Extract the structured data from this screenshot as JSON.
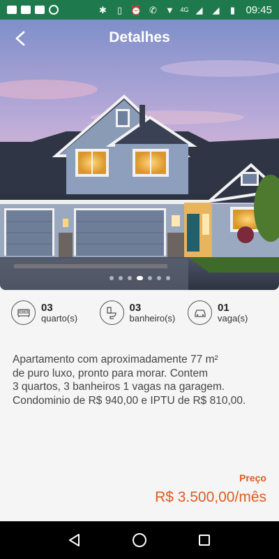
{
  "status_bar": {
    "time": "09:45",
    "network": "4G"
  },
  "header": {
    "title": "Detalhes"
  },
  "carousel": {
    "slide_count": 7,
    "active_index": 3
  },
  "features": [
    {
      "value": "03",
      "label": "quarto(s)",
      "icon": "bed-icon"
    },
    {
      "value": "03",
      "label": "banheiro(s)",
      "icon": "toilet-icon"
    },
    {
      "value": "01",
      "label": "vaga(s)",
      "icon": "car-icon"
    }
  ],
  "description": {
    "line1": "Apartamento com aproximadamente 77 m²",
    "line2": "de puro luxo, pronto para morar. Contem",
    "line3": "3 quartos, 3 banheiros 1 vagas na garagem.",
    "line4": "Condominio de R$ 940,00 e IPTU de R$ 810,00."
  },
  "price": {
    "label": "Preço",
    "value": "R$ 3.500,00/mês"
  },
  "colors": {
    "status_bar": "#1e7a4c",
    "accent": "#e05a1e"
  }
}
